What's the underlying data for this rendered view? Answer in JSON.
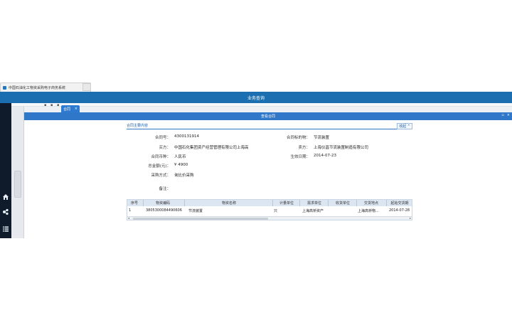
{
  "browser": {
    "tab_title": "中国石油化工物资采购电子商务系统"
  },
  "header": {
    "title": "业务查询"
  },
  "toolbar": {
    "dots": "▪ ▪ ▪"
  },
  "tabs": [
    {
      "label": "合同",
      "close": "×"
    }
  ],
  "modal": {
    "title": "查看合同",
    "restore": "▫",
    "close": "×"
  },
  "section": {
    "title": "合同主要内容",
    "collapse_label": "收起 ^"
  },
  "fields": {
    "contract_no": {
      "label": "合同号：",
      "value": "4300131914"
    },
    "buyer": {
      "label": "买方：",
      "value": "中国石化集团资产经营管理有限公司上海高"
    },
    "currency": {
      "label": "合同币种：",
      "value": "人民币"
    },
    "total": {
      "label": "总金额(元)：",
      "value": "¥ 4900"
    },
    "method": {
      "label": "采购方式：",
      "value": "询比价采购"
    },
    "remark": {
      "label": "备注：",
      "value": ""
    },
    "subject": {
      "label": "合同标的物：",
      "value": "节流装置"
    },
    "seller": {
      "label": "卖方：",
      "value": "上海仪昌节流装置制造有限公司"
    },
    "effective": {
      "label": "生效日期：",
      "value": "2014-07-23"
    }
  },
  "table": {
    "headers": [
      "序号",
      "物资编码",
      "物资名称",
      "计量单位",
      "需求单位",
      "收货单位",
      "交货地点",
      "起始交货期"
    ],
    "rows": [
      [
        "1",
        "3805300084490606",
        "节流装置",
        "只",
        "上海高桥资产",
        "",
        "上海高桥物...",
        "2014-07-28"
      ]
    ],
    "scroll_left": "◂",
    "scroll_right": "▸"
  },
  "icons": {
    "home": "home-icon",
    "network": "network-icon",
    "list": "list-icon"
  },
  "colors": {
    "header_blue": "#1b6fb0",
    "modal_blue": "#2f78c9",
    "sidebar_dark": "#0f1a2a"
  }
}
